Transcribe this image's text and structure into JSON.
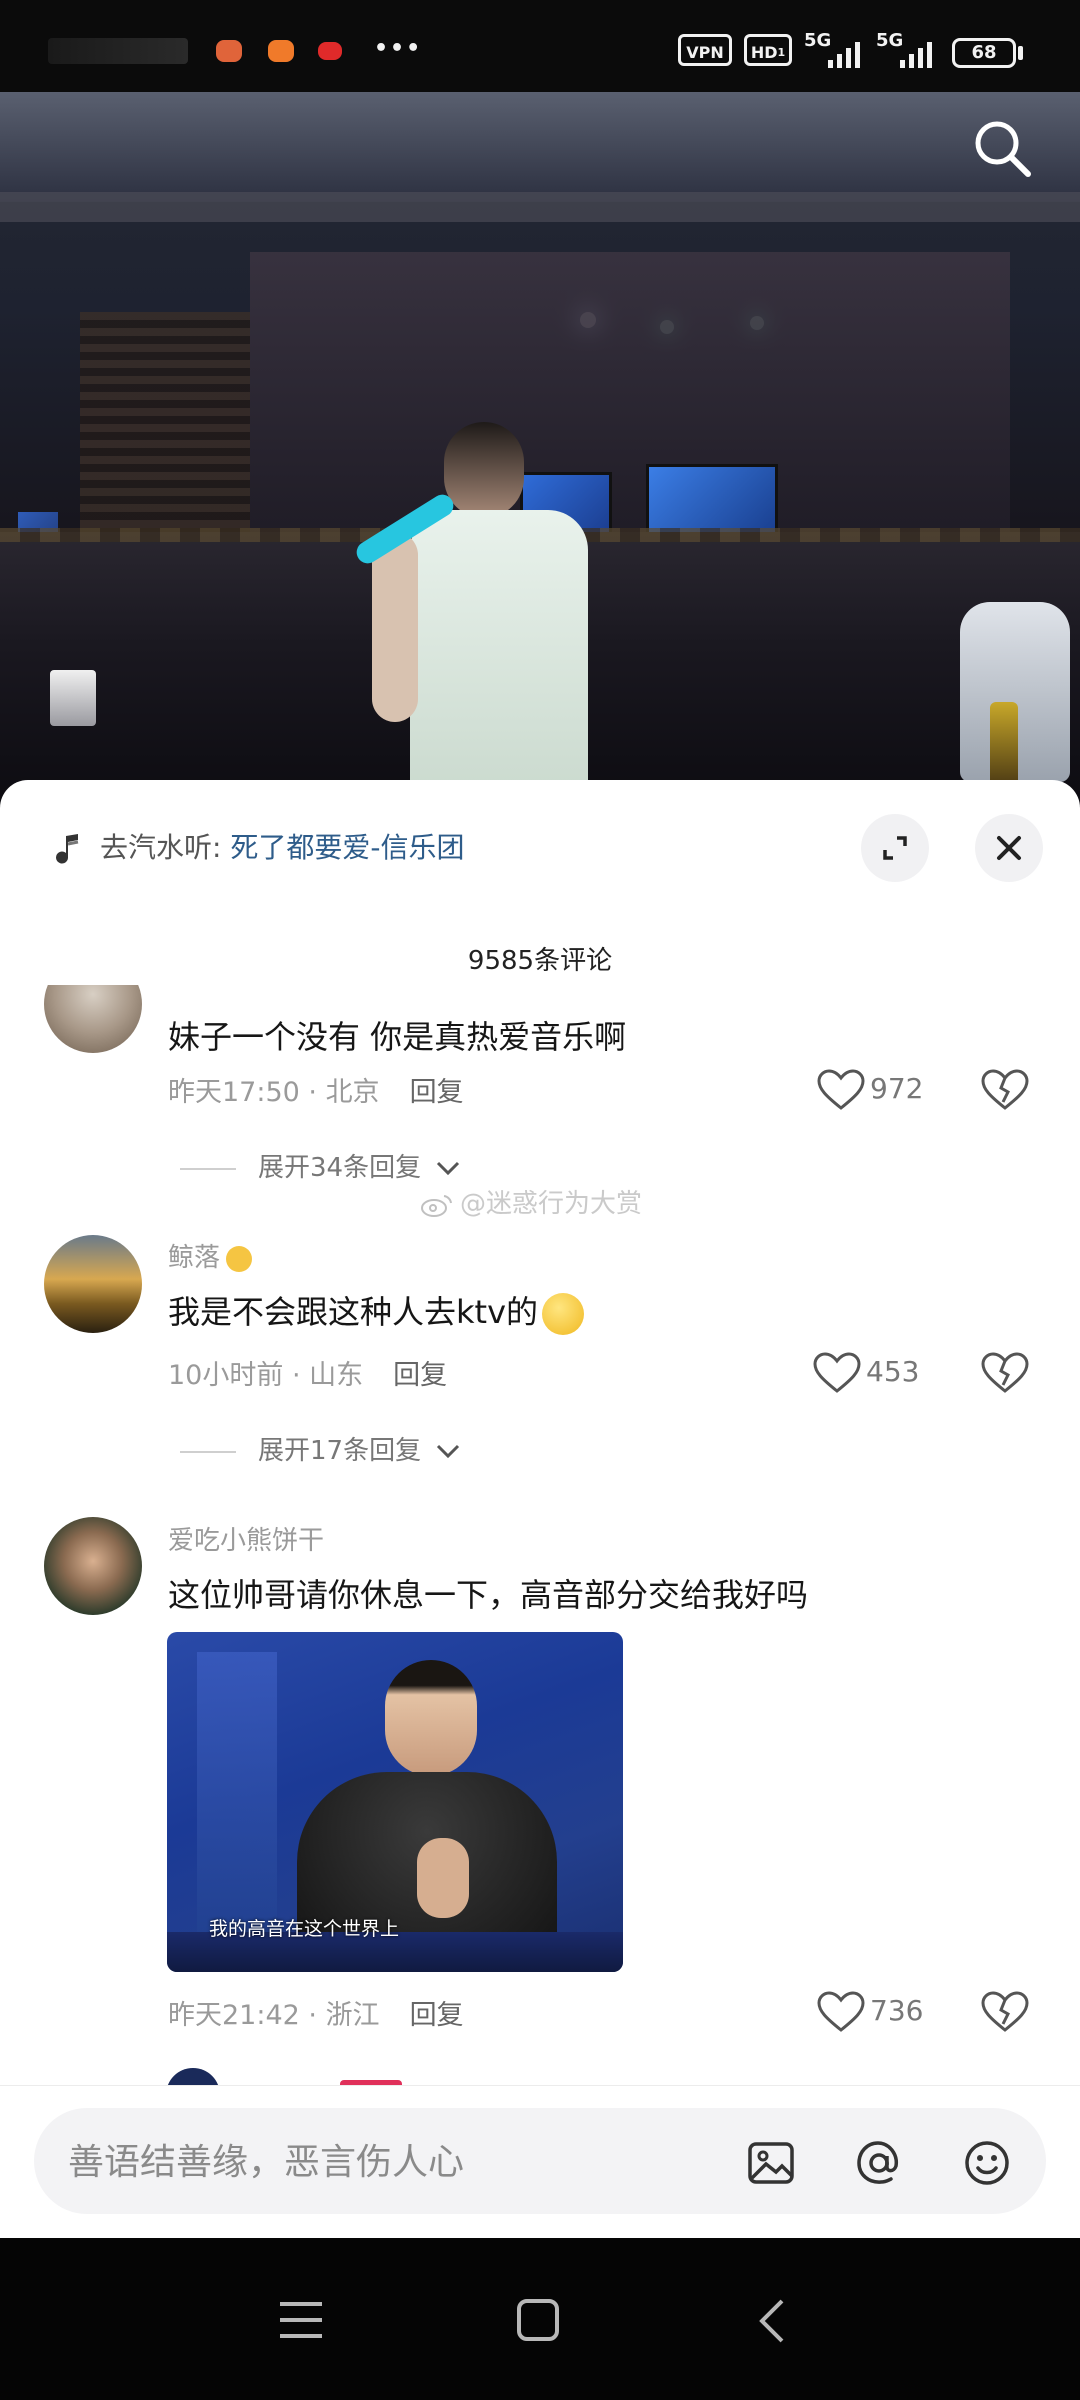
{
  "status_bar": {
    "vpn": "VPN",
    "hd": "HD",
    "hd_sup": "1",
    "hd_sub": "2",
    "net1": "5G",
    "net2": "5G",
    "battery": "68",
    "more": "•••"
  },
  "video": {
    "search_icon": "search-icon"
  },
  "music": {
    "prefix": "去汽水听: ",
    "song": "死了都要爱-信乐团"
  },
  "comments_header": {
    "count_label": "9585条评论"
  },
  "comments": [
    {
      "text": "妹子一个没有 你是真热爱音乐啊",
      "time": "昨天17:50",
      "location": "北京",
      "reply": "回复",
      "likes": "972",
      "expand": "展开34条回复"
    },
    {
      "user": "鲸落",
      "text": "我是不会跟这种人去ktv的",
      "time": "10小时前",
      "location": "山东",
      "reply": "回复",
      "likes": "453",
      "expand": "展开17条回复"
    },
    {
      "user": "爱吃小熊饼干",
      "text": "这位帅哥请你休息一下，高音部分交给我好吗",
      "image_caption": "我的高音在这个世界上",
      "time": "昨天21:42",
      "location": "浙江",
      "reply": "回复",
      "likes": "736"
    }
  ],
  "watermark": "@迷惑行为大赏",
  "input": {
    "placeholder": "善语结善缘，恶言伤人心"
  },
  "colors": {
    "accent_link": "#2e5c8a",
    "panel_bg": "#ffffff"
  }
}
